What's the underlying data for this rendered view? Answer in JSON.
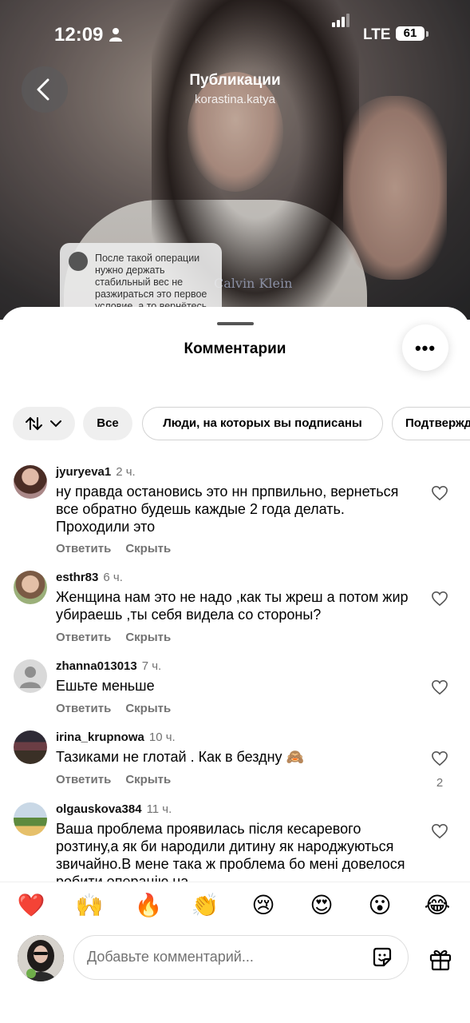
{
  "status_bar": {
    "time": "12:09",
    "network": "LTE",
    "battery": "61"
  },
  "header": {
    "title": "Публикации",
    "subtitle": "korastina.katya"
  },
  "video": {
    "caption_bubble": "После такой операции нужно держать стабильный вес не разжираться это  первое условие, а то вернётесь",
    "shirt_brand": "Calvin Klein"
  },
  "sheet": {
    "title": "Комментарии",
    "more_label": "•••"
  },
  "filters": {
    "sort_icon": "sort-arrows-icon",
    "chips": [
      "Все",
      "Люди, на которых вы подписаны",
      "Подтвержд"
    ]
  },
  "comments": [
    {
      "user": "jyuryeva1",
      "time": "2 ч.",
      "text": "ну правда остановись это нн прпвильно, вернеться все обратно будешь каждые 2 года делать. Проходили это",
      "reply": "Ответить",
      "hide": "Скрыть",
      "likes": ""
    },
    {
      "user": "esthr83",
      "time": "6 ч.",
      "text": "Женщина нам это не надо ,как ты жреш а потом жир убираешь ,ты себя видела со стороны?",
      "reply": "Ответить",
      "hide": "Скрыть",
      "likes": ""
    },
    {
      "user": "zhanna013013",
      "time": "7 ч.",
      "text": "Ешьте меньше",
      "reply": "Ответить",
      "hide": "Скрыть",
      "likes": ""
    },
    {
      "user": "irina_krupnowa",
      "time": "10 ч.",
      "text": "Тазиками не глотай . Как в бездну 🙈",
      "reply": "Ответить",
      "hide": "Скрыть",
      "likes": "2"
    },
    {
      "user": "olgauskova384",
      "time": "11 ч.",
      "text": "Ваша проблема проявилась після кесаревого розтину,а як би народили дитину як народжуються звичайно.В мене така ж проблема бо мені довелося робити операцію на",
      "reply": "",
      "hide": "",
      "likes": ""
    }
  ],
  "emoji_bar": [
    "❤️",
    "🙌",
    "🔥",
    "👏",
    "😢",
    "😍",
    "😮",
    "😂"
  ],
  "composer": {
    "placeholder": "Добавьте комментарий..."
  }
}
